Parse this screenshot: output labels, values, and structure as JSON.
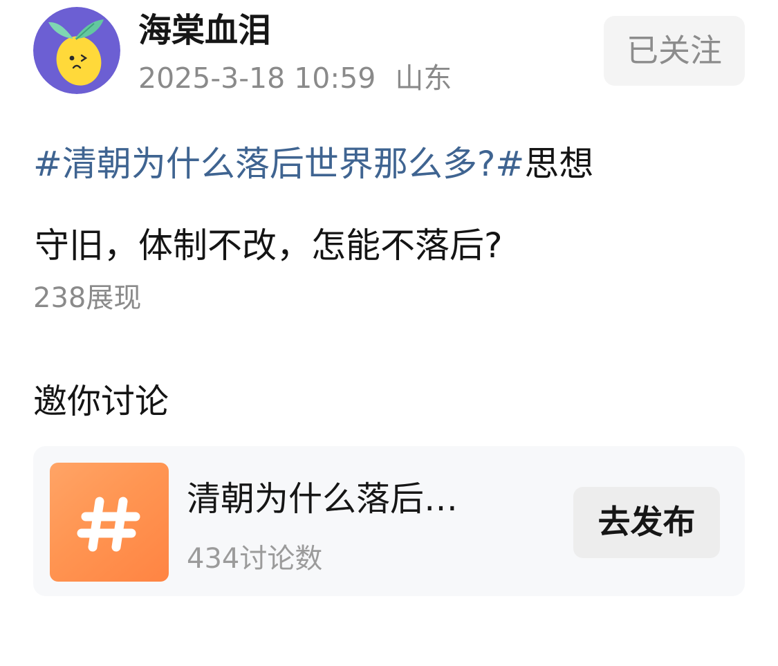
{
  "author": {
    "name": "海棠血泪",
    "avatar_icon": "lemon-mascot-icon",
    "avatar_bg_color": "#6c5fd3"
  },
  "post": {
    "timestamp": "2025-3-18 10:59",
    "location": "山东",
    "topic_tag": "#清朝为什么落后世界那么多?#",
    "text_line1_tail": "思想",
    "text_line2": "守旧，体制不改，怎能不落后?",
    "impressions": "238展现",
    "link_color": "#3f6491"
  },
  "follow": {
    "label": "已关注"
  },
  "discussion": {
    "section_title": "邀你讨论",
    "card": {
      "icon": "hashtag-icon",
      "icon_color": "#ff9552",
      "title": "清朝为什么落后…",
      "count": "434讨论数",
      "button_label": "去发布"
    }
  }
}
